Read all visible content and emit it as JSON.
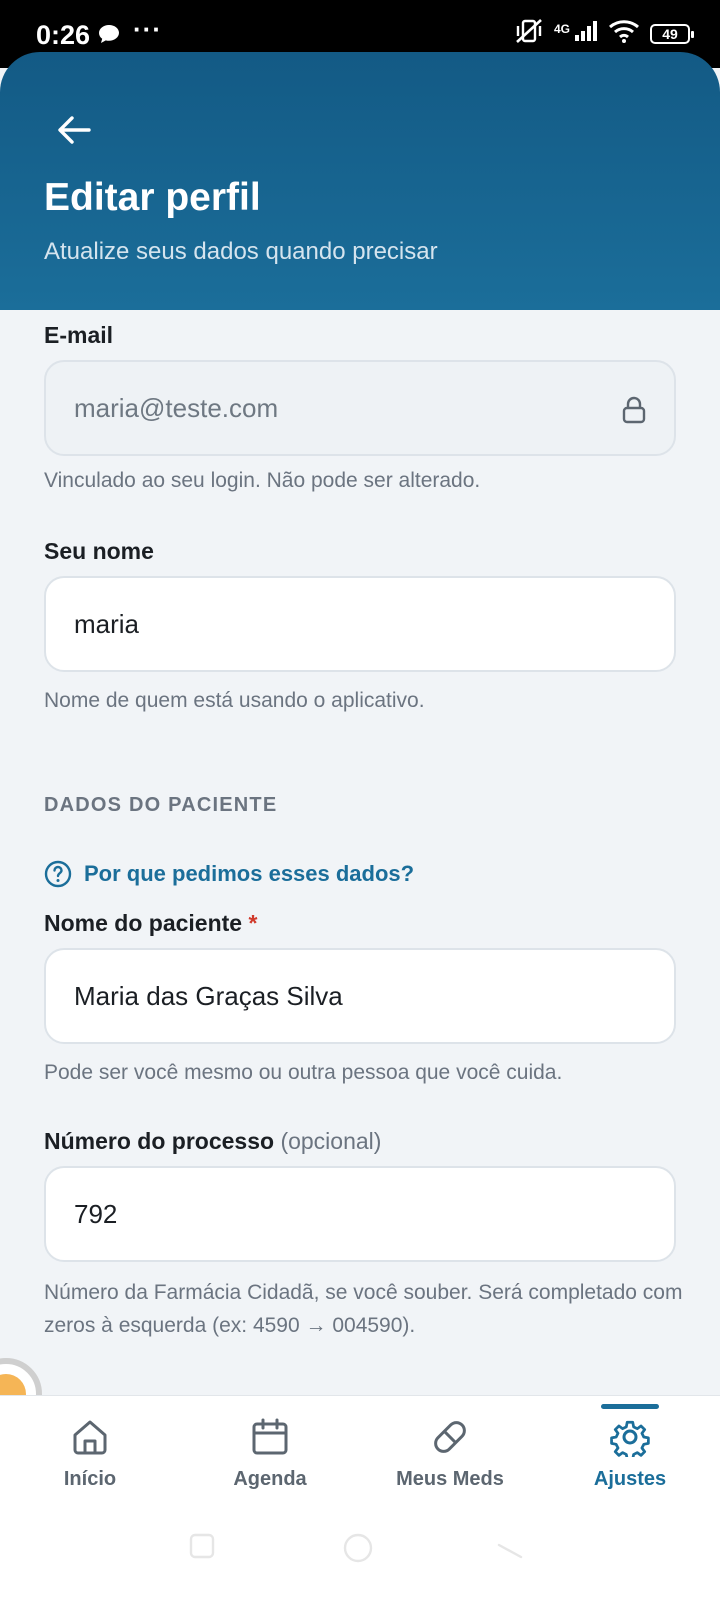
{
  "status_bar": {
    "time": "0:26",
    "network": "4G",
    "battery": "49"
  },
  "header": {
    "title": "Editar perfil",
    "subtitle": "Atualize seus dados quando precisar"
  },
  "form": {
    "email": {
      "label": "E-mail",
      "value": "maria@teste.com",
      "hint": "Vinculado ao seu login. Não pode ser alterado."
    },
    "name": {
      "label": "Seu nome",
      "value": "maria",
      "hint": "Nome de quem está usando o aplicativo."
    },
    "patient_section": {
      "title": "DADOS DO PACIENTE",
      "why_link": "Por que pedimos esses dados?"
    },
    "patient_name": {
      "label": "Nome do paciente",
      "required_mark": "*",
      "value": "Maria das Graças Silva",
      "hint": "Pode ser você mesmo ou outra pessoa que você cuida."
    },
    "process_number": {
      "label": "Número do processo",
      "optional_label": "(opcional)",
      "value": "792",
      "hint": "Número da Farmácia Cidadã, se você souber. Será completado com zeros à esquerda (ex: 4590 → 004590)."
    }
  },
  "nav": {
    "items": [
      {
        "label": "Início",
        "icon": "home-icon"
      },
      {
        "label": "Agenda",
        "icon": "calendar-icon"
      },
      {
        "label": "Meus Meds",
        "icon": "pill-icon"
      },
      {
        "label": "Ajustes",
        "icon": "gear-icon"
      }
    ],
    "active": "Ajustes"
  },
  "colors": {
    "header": "#135a85",
    "accent": "#1b6e9a",
    "required": "#d0392b",
    "background": "#f1f4f7"
  }
}
